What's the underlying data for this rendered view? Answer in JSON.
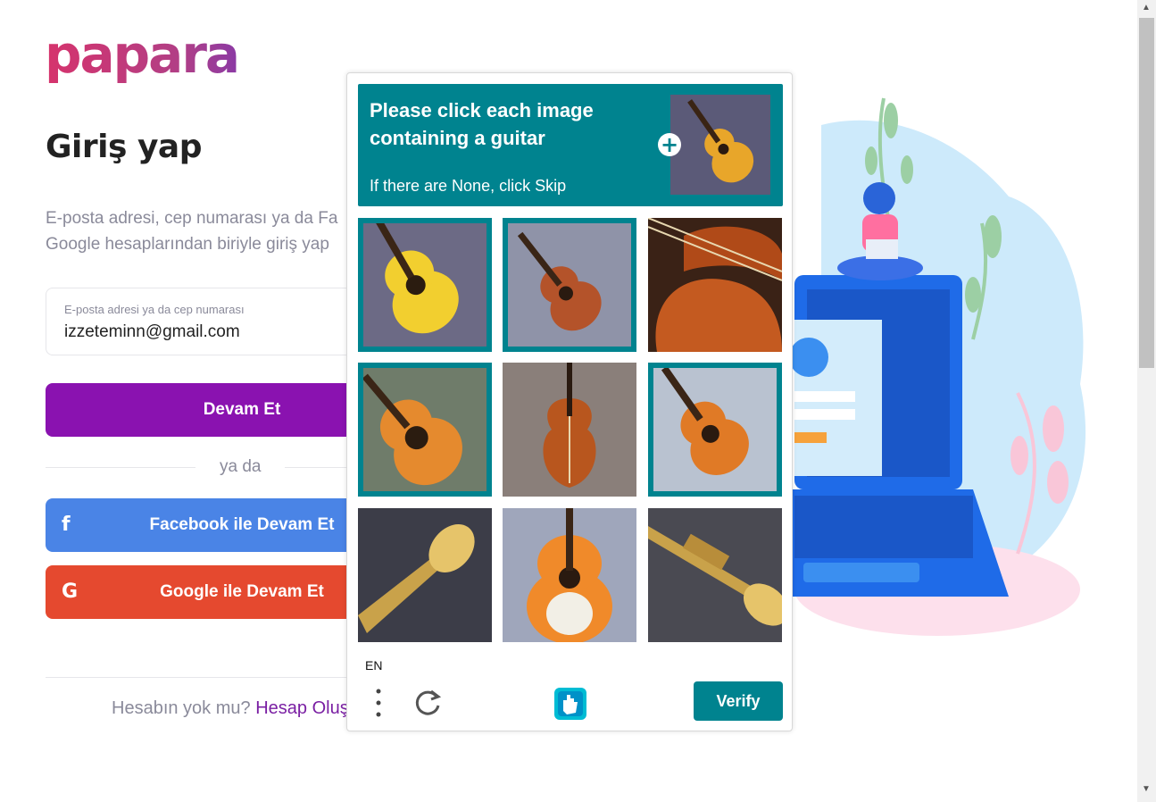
{
  "brand": {
    "logo_text": "papara"
  },
  "login": {
    "title": "Giriş yap",
    "description_line1": "E-posta adresi, cep numarası ya da Fa",
    "description_line2": "Google hesaplarından biriyle giriş yap",
    "email_label": "E-posta adresi ya da cep numarası",
    "email_value": "izzeteminn@gmail.com",
    "continue_label": "Devam Et",
    "or_label": "ya da",
    "facebook_label": "Facebook ile Devam Et",
    "google_label": "Google ile Devam Et",
    "signup_prompt": "Hesabın yok mu?",
    "signup_link": "Hesap Oluş"
  },
  "captcha": {
    "prompt": "Please click each image containing a guitar",
    "subprompt": "If there are None, click Skip",
    "language": "EN",
    "verify_label": "Verify",
    "accent_color": "#00838f",
    "tiles": [
      {
        "content": "yellow acoustic guitar",
        "selected": true
      },
      {
        "content": "brown acoustic guitar",
        "selected": true
      },
      {
        "content": "violin body closeup",
        "selected": false
      },
      {
        "content": "orange acoustic guitar",
        "selected": true
      },
      {
        "content": "violin",
        "selected": false
      },
      {
        "content": "orange acoustic guitar",
        "selected": true
      },
      {
        "content": "trumpet bell",
        "selected": false
      },
      {
        "content": "orange and white guitar",
        "selected": false
      },
      {
        "content": "trumpet",
        "selected": false
      }
    ]
  },
  "icons": {
    "facebook": "facebook-icon",
    "google": "google-icon",
    "menu": "more-vertical-icon",
    "refresh": "refresh-icon",
    "hcaptcha": "hcaptcha-logo-icon"
  },
  "colors": {
    "primary": "#8a12b0",
    "facebook": "#4a84e6",
    "google": "#e5492f"
  }
}
